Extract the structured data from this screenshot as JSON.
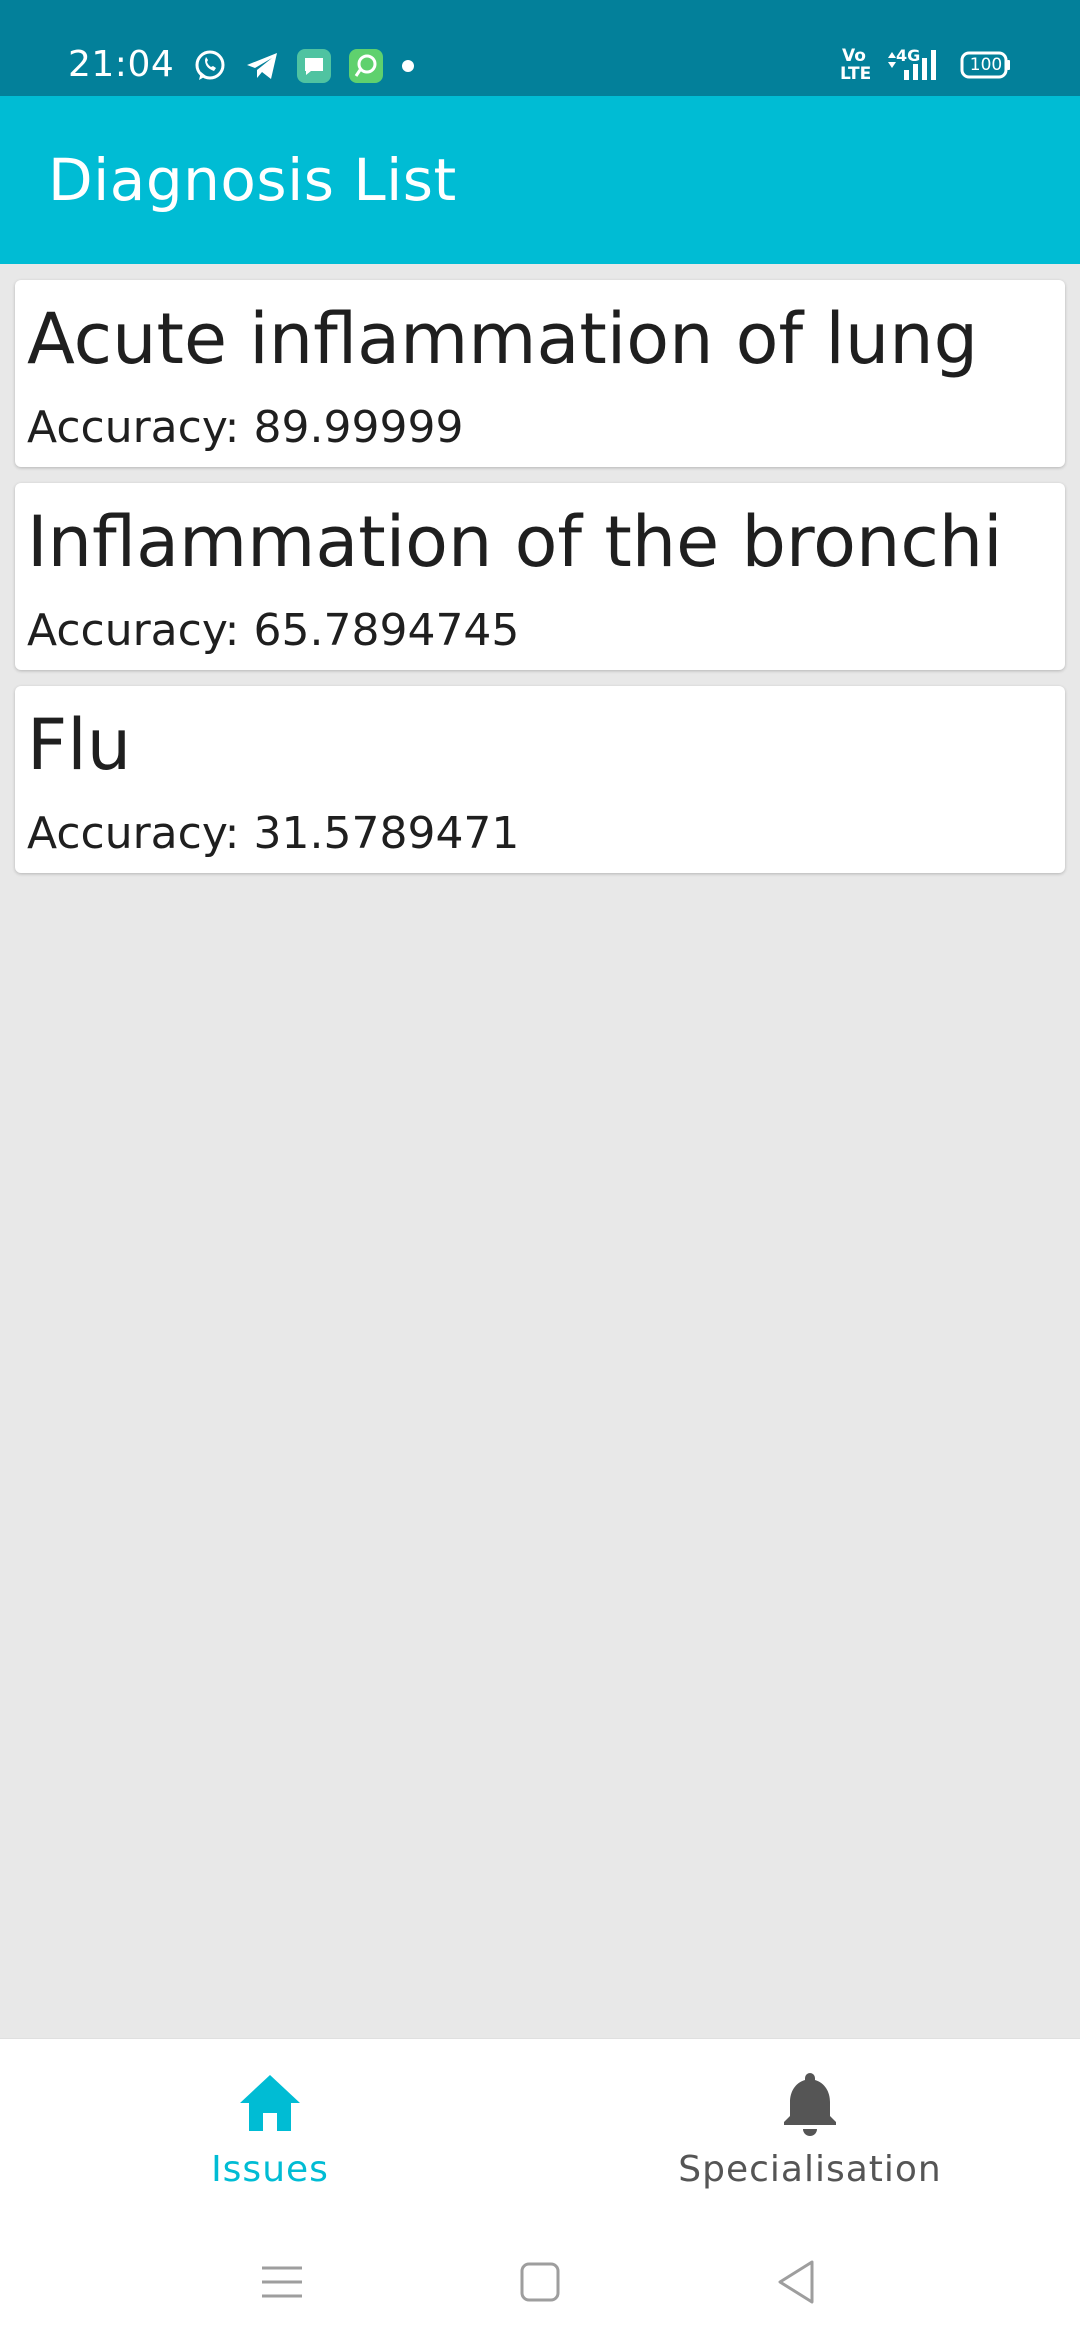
{
  "status_bar": {
    "time": "21:04",
    "icons": [
      "whatsapp-icon",
      "telegram-icon",
      "message-icon",
      "app-notification-icon",
      "more-dot-icon"
    ],
    "network_top": "Vo",
    "network_bottom": "LTE",
    "network_type": "4G",
    "battery": "100",
    "background_color": "#03809a"
  },
  "app_bar": {
    "title": "Diagnosis List",
    "background_color": "#00bcd4"
  },
  "diagnoses": [
    {
      "name": "Acute inflammation of lung",
      "accuracy": "Accuracy: 89.99999"
    },
    {
      "name": "Inflammation of the bronchi",
      "accuracy": "Accuracy: 65.7894745"
    },
    {
      "name": "Flu",
      "accuracy": "Accuracy: 31.5789471"
    }
  ],
  "bottom_nav": {
    "items": [
      {
        "label": "Issues",
        "icon": "home-icon",
        "active": true
      },
      {
        "label": "Specialisation",
        "icon": "bell-icon",
        "active": false
      }
    ],
    "active_color": "#00bcd4",
    "inactive_color": "#555555"
  },
  "system_nav": {
    "buttons": [
      "menu-icon",
      "home-square-icon",
      "back-icon"
    ]
  }
}
